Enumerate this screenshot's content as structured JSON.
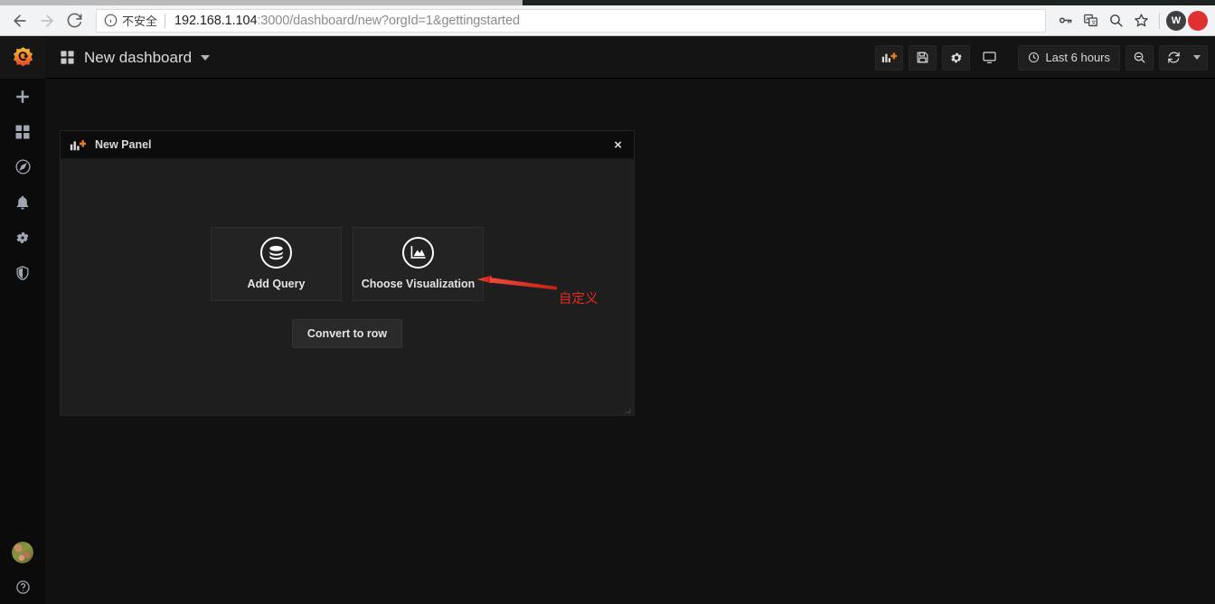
{
  "browser": {
    "back_icon": "back-arrow-icon",
    "forward_icon": "forward-arrow-icon",
    "reload_icon": "reload-icon",
    "security_label": "不安全",
    "info_icon": "info-circle-icon",
    "url_host": "192.168.1.104",
    "url_rest": ":3000/dashboard/new?orgId=1&gettingstarted",
    "url_full": "192.168.1.104:3000/dashboard/new?orgId=1&gettingstarted",
    "toolbar_icons": [
      {
        "name": "password-key-icon"
      },
      {
        "name": "translate-icon"
      },
      {
        "name": "zoom-search-icon"
      },
      {
        "name": "bookmark-star-icon"
      }
    ],
    "extensions": [
      {
        "name": "extension-w-icon",
        "label": "W",
        "color": "#3c4043"
      },
      {
        "name": "extension-red-icon",
        "label": "",
        "color": "#e03131"
      }
    ]
  },
  "sidebar": {
    "logo_name": "grafana-logo-icon",
    "items": [
      {
        "name": "sidebar-item-create",
        "icon": "plus-icon",
        "label": "Create"
      },
      {
        "name": "sidebar-item-dashboards",
        "icon": "dashboards-grid-icon",
        "label": "Dashboards"
      },
      {
        "name": "sidebar-item-explore",
        "icon": "compass-icon",
        "label": "Explore"
      },
      {
        "name": "sidebar-item-alerting",
        "icon": "bell-icon",
        "label": "Alerting"
      },
      {
        "name": "sidebar-item-configuration",
        "icon": "gear-icon",
        "label": "Configuration"
      },
      {
        "name": "sidebar-item-server-admin",
        "icon": "shield-icon",
        "label": "Server Admin"
      }
    ],
    "bottom": [
      {
        "name": "user-avatar",
        "icon": "avatar-icon",
        "label": "User"
      },
      {
        "name": "help-menu",
        "icon": "question-circle-icon",
        "label": "Help"
      }
    ]
  },
  "topnav": {
    "dashboards_icon": "dashboards-grid-icon",
    "title": "New dashboard",
    "caret_icon": "chevron-down-icon",
    "tools": [
      {
        "name": "add-panel-button",
        "icon": "add-panel-icon"
      },
      {
        "name": "save-dashboard-button",
        "icon": "save-floppy-icon"
      },
      {
        "name": "dashboard-settings-button",
        "icon": "gear-icon"
      },
      {
        "name": "cycle-view-mode-button",
        "icon": "monitor-icon"
      }
    ],
    "timepicker": {
      "clock_icon": "clock-icon",
      "label": "Last 6 hours"
    },
    "zoom_out_icon": "zoom-out-icon",
    "refresh_icon": "refresh-icon",
    "refresh_caret_icon": "chevron-down-icon"
  },
  "panel": {
    "icon": "add-panel-icon",
    "title": "New Panel",
    "close_icon": "×",
    "cards": [
      {
        "name": "add-query-card",
        "icon": "database-stack-icon",
        "label": "Add Query"
      },
      {
        "name": "choose-visualization-card",
        "icon": "area-graph-icon",
        "label": "Choose Visualization"
      }
    ],
    "convert_row_label": "Convert to row",
    "resize_handle_icon": "resize-handle-icon"
  },
  "annotation": {
    "text": "自定义",
    "arrow_color": "#e8291f",
    "arrow_icon": "arrow-left-icon"
  },
  "colors": {
    "page_background": "#111111",
    "panel_background": "#1e1e1e",
    "panel_header_background": "#0c0c0c",
    "sidebar_background": "#0b0b0b",
    "topnav_background": "#141414",
    "accent_orange": "#eb7b18",
    "annotation_red": "#e8291f",
    "text_primary": "#d8d9da"
  }
}
